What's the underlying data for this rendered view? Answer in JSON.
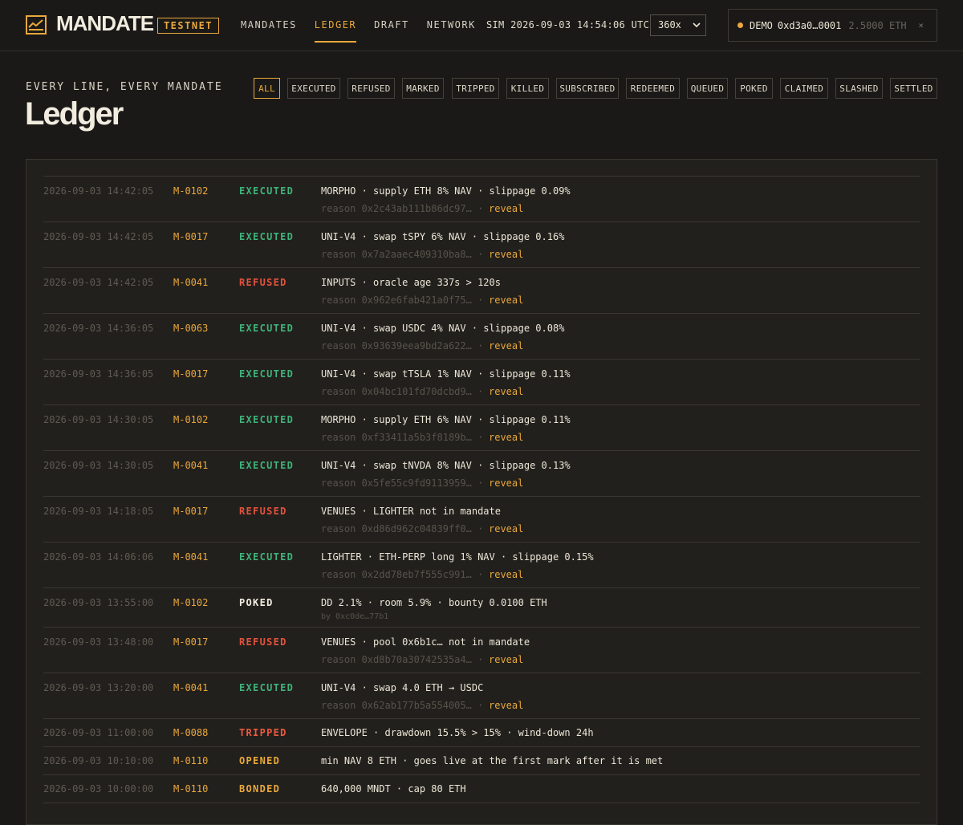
{
  "app": {
    "name": "MANDATE",
    "network_badge": "TESTNET",
    "colors": {
      "accent": "#e9a83c",
      "success": "#3fb37a",
      "danger": "#e2533e",
      "background": "#1a1917"
    }
  },
  "nav": {
    "items": [
      {
        "label": "MANDATES",
        "active": false
      },
      {
        "label": "LEDGER",
        "active": true
      },
      {
        "label": "DRAFT",
        "active": false
      },
      {
        "label": "NETWORK",
        "active": false
      }
    ]
  },
  "sim": {
    "clock": "SIM 2026-09-03 14:54:06 UTC",
    "speed": "360x"
  },
  "wallet": {
    "label": "DEMO",
    "address": "0xd3a0…0001",
    "balance": "2.5000 ETH",
    "close": "×"
  },
  "header": {
    "eyebrow": "EVERY LINE, EVERY MANDATE",
    "title": "Ledger"
  },
  "filters": [
    {
      "label": "ALL",
      "active": true
    },
    {
      "label": "EXECUTED",
      "active": false
    },
    {
      "label": "REFUSED",
      "active": false
    },
    {
      "label": "MARKED",
      "active": false
    },
    {
      "label": "TRIPPED",
      "active": false
    },
    {
      "label": "KILLED",
      "active": false
    },
    {
      "label": "SUBSCRIBED",
      "active": false
    },
    {
      "label": "REDEEMED",
      "active": false
    },
    {
      "label": "QUEUED",
      "active": false
    },
    {
      "label": "POKED",
      "active": false
    },
    {
      "label": "CLAIMED",
      "active": false
    },
    {
      "label": "SLASHED",
      "active": false
    },
    {
      "label": "SETTLED",
      "active": false
    }
  ],
  "ledger": {
    "reveal_label": "reveal",
    "rows": [
      {
        "time": "2026-09-03 14:42:05",
        "id": "M-0102",
        "status": "EXECUTED",
        "desc": "MORPHO · supply ETH 8% NAV · slippage 0.09%",
        "reason": "reason 0x2c43ab111b86dc97… ·"
      },
      {
        "time": "2026-09-03 14:42:05",
        "id": "M-0017",
        "status": "EXECUTED",
        "desc": "UNI-V4 · swap tSPY 6% NAV · slippage 0.16%",
        "reason": "reason 0x7a2aaec409310ba8… ·"
      },
      {
        "time": "2026-09-03 14:42:05",
        "id": "M-0041",
        "status": "REFUSED",
        "desc": "INPUTS · oracle age 337s > 120s",
        "reason": "reason 0x962e6fab421a0f75… ·"
      },
      {
        "time": "2026-09-03 14:36:05",
        "id": "M-0063",
        "status": "EXECUTED",
        "desc": "UNI-V4 · swap USDC 4% NAV · slippage 0.08%",
        "reason": "reason 0x93639eea9bd2a622… ·"
      },
      {
        "time": "2026-09-03 14:36:05",
        "id": "M-0017",
        "status": "EXECUTED",
        "desc": "UNI-V4 · swap tTSLA 1% NAV · slippage 0.11%",
        "reason": "reason 0x04bc101fd70dcbd9… ·"
      },
      {
        "time": "2026-09-03 14:30:05",
        "id": "M-0102",
        "status": "EXECUTED",
        "desc": "MORPHO · supply ETH 6% NAV · slippage 0.11%",
        "reason": "reason 0xf33411a5b3f8189b… ·"
      },
      {
        "time": "2026-09-03 14:30:05",
        "id": "M-0041",
        "status": "EXECUTED",
        "desc": "UNI-V4 · swap tNVDA 8% NAV · slippage 0.13%",
        "reason": "reason 0x5fe55c9fd9113959… ·"
      },
      {
        "time": "2026-09-03 14:18:05",
        "id": "M-0017",
        "status": "REFUSED",
        "desc": "VENUES · LIGHTER not in mandate",
        "reason": "reason 0xd86d962c04839ff0… ·"
      },
      {
        "time": "2026-09-03 14:06:06",
        "id": "M-0041",
        "status": "EXECUTED",
        "desc": "LIGHTER · ETH-PERP long 1% NAV · slippage 0.15%",
        "reason": "reason 0x2dd78eb7f555c991… ·"
      },
      {
        "time": "2026-09-03 13:55:00",
        "id": "M-0102",
        "status": "POKED",
        "desc": "DD 2.1% · room 5.9% · bounty 0.0100 ETH",
        "by": "by 0xc0de…77b1"
      },
      {
        "time": "2026-09-03 13:48:00",
        "id": "M-0017",
        "status": "REFUSED",
        "desc": "VENUES · pool 0x6b1c… not in mandate",
        "reason": "reason 0xd8b70a30742535a4… ·"
      },
      {
        "time": "2026-09-03 13:20:00",
        "id": "M-0041",
        "status": "EXECUTED",
        "desc": "UNI-V4 · swap 4.0 ETH → USDC",
        "reason": "reason 0x62ab177b5a554005… ·"
      },
      {
        "time": "2026-09-03 11:00:00",
        "id": "M-0088",
        "status": "TRIPPED",
        "desc": "ENVELOPE · drawdown 15.5% > 15% · wind-down 24h"
      },
      {
        "time": "2026-09-03 10:10:00",
        "id": "M-0110",
        "status": "OPENED",
        "desc": "min NAV 8 ETH · goes live at the first mark after it is met"
      },
      {
        "time": "2026-09-03 10:00:00",
        "id": "M-0110",
        "status": "BONDED",
        "desc": "640,000 MNDT · cap 80 ETH"
      }
    ]
  }
}
